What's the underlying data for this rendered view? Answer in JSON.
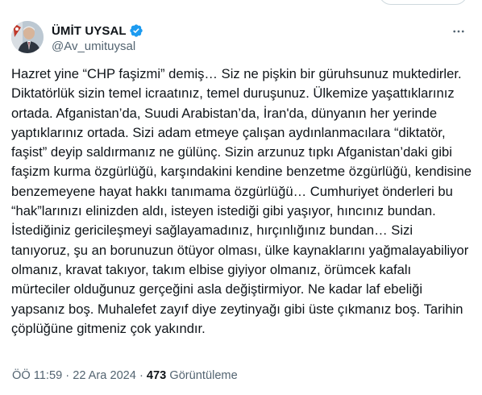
{
  "author": {
    "display_name": "ÜMİT UYSAL",
    "handle": "@Av_umituysal",
    "verified": true
  },
  "icons": {
    "verified": "verified-badge-icon",
    "more": "more-horizontal-icon"
  },
  "tweet": {
    "text": "Hazret yine “CHP faşizmi” demiş… Siz ne pişkin bir güruhsunuz muktedirler. Diktatörlük sizin temel icraatınız, temel duruşunuz. Ülkemize yaşattıklarınız ortada. Afganistan’da, Suudi Arabistan’da, İran'da, dünyanın her yerinde yaptıklarınız ortada. Sizi adam etmeye çalışan aydınlanmacılara “diktatör, faşist” deyip saldırmanız ne gülünç. Sizin arzunuz tıpkı Afganistan’daki gibi faşizm kurma özgürlüğü, karşındakini kendine benzetme özgürlüğü, kendisine benzemeyene hayat hakkı tanımama özgürlüğü… Cumhuriyet  önderleri bu “hak”larınızı elinizden aldı, isteyen istediği gibi yaşıyor, hıncınız bundan. İstediğiniz gericileşmeyi sağlayamadınız, hırçınlığınız bundan… Sizi tanıyoruz, şu an borunuzun ötüyor olması, ülke kaynaklarını yağmalayabiliyor olmanız, kravat takıyor, takım elbise giyiyor olmanız, örümcek kafalı mürteciler olduğunuz gerçeğini asla değiştirmiyor. Ne kadar laf ebeliği yapsanız boş. Muhalefet zayıf diye zeytinyağı gibi üste çıkmanız boş. Tarihin çöplüğüne gitmeniz çok yakındır."
  },
  "meta": {
    "time": "ÖÖ 11:59",
    "separator": "·",
    "date": "22 Ara 2024",
    "views_count": "473",
    "views_label": "Görüntüleme"
  },
  "colors": {
    "text": "#0f1419",
    "secondary": "#536471",
    "verified": "#1d9bf0"
  }
}
